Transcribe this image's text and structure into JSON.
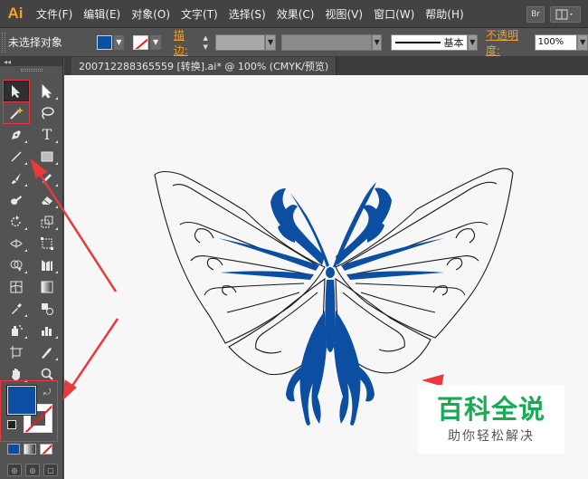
{
  "app": {
    "logo": "Ai"
  },
  "menu": [
    "文件(F)",
    "编辑(E)",
    "对象(O)",
    "文字(T)",
    "选择(S)",
    "效果(C)",
    "视图(V)",
    "窗口(W)",
    "帮助(H)"
  ],
  "menu_right": {
    "bridge_label": "Br"
  },
  "control_bar": {
    "selection_status": "未选择对象",
    "stroke_label": "描边:",
    "brush_label": "基本",
    "opacity_label": "不透明度:",
    "opacity_value": "100%"
  },
  "document": {
    "tab_title": "200712288365559 [转换].ai* @ 100% (CMYK/预览)"
  },
  "tools": {
    "type_tool_glyph": "T"
  },
  "colors": {
    "fill": "#0b4ea2",
    "accent": "#f7a21b",
    "annotation": "#e8393d"
  },
  "watermark": {
    "title": "百科全说",
    "subtitle": "助你轻松解决"
  }
}
